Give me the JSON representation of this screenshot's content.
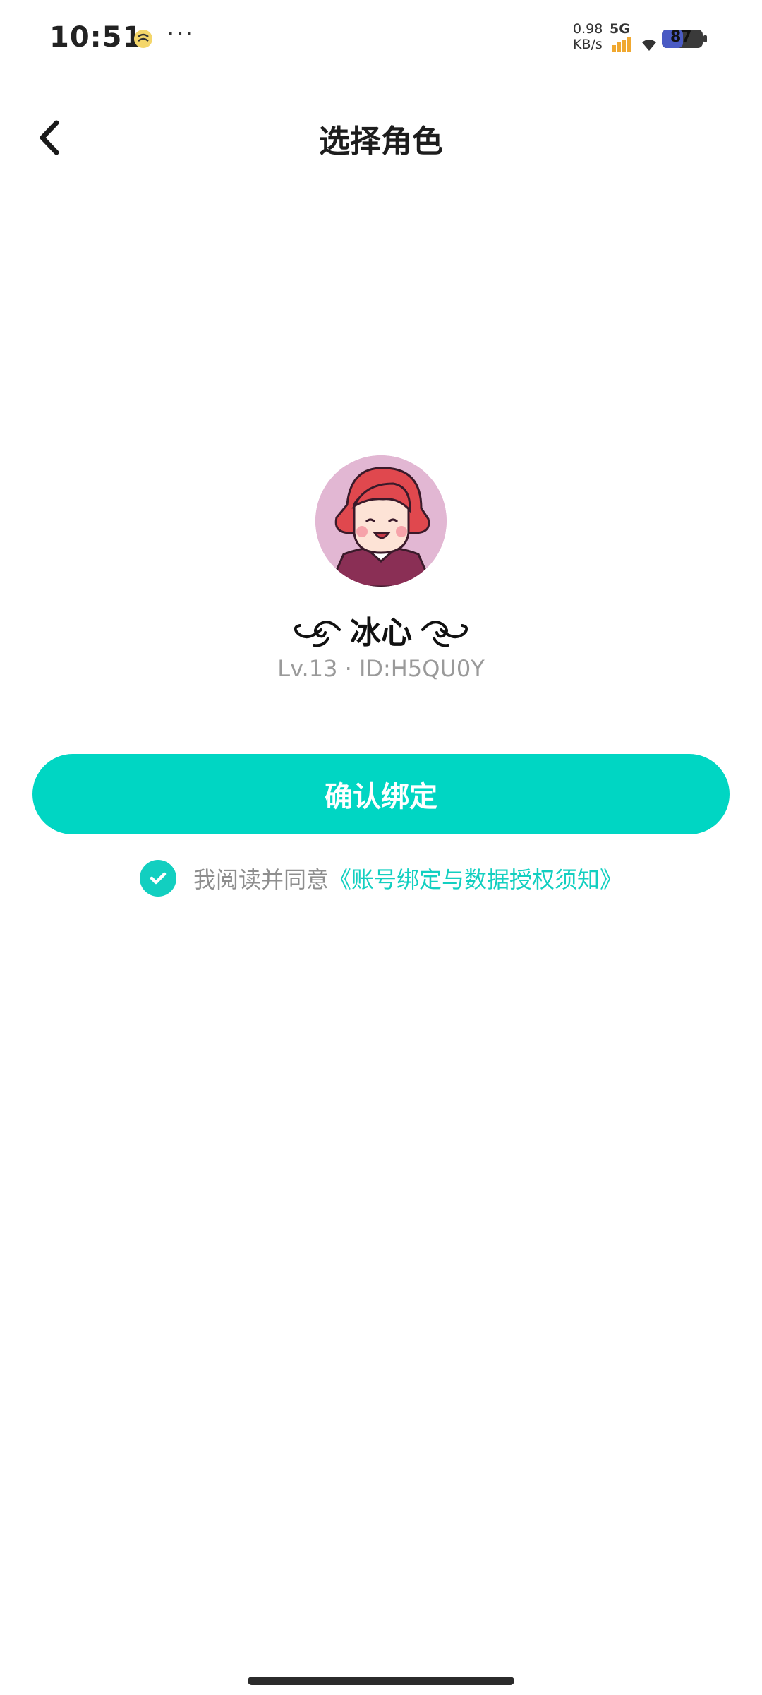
{
  "status_bar": {
    "time": "10:51",
    "net_speed_value": "0.98",
    "net_speed_unit": "KB/s",
    "network_type": "5G",
    "battery": "87",
    "icons": [
      "notification-app-icon",
      "more-icon",
      "signal-icon",
      "wifi-icon",
      "battery-icon"
    ]
  },
  "header": {
    "title": "选择角色",
    "back_icon": "chevron-left-icon"
  },
  "profile": {
    "nickname": "冰心",
    "level_id": "Lv.13 · ID:H5QU0Y",
    "avatar_icon": "cartoon-girl-avatar"
  },
  "actions": {
    "confirm_label": "确认绑定"
  },
  "agreement": {
    "checked": true,
    "prefix": "我阅读并同意",
    "link": "《账号绑定与数据授权须知》"
  },
  "colors": {
    "accent": "#00d6c3",
    "link": "#12cfc0",
    "text_secondary": "#9a9a9a"
  }
}
